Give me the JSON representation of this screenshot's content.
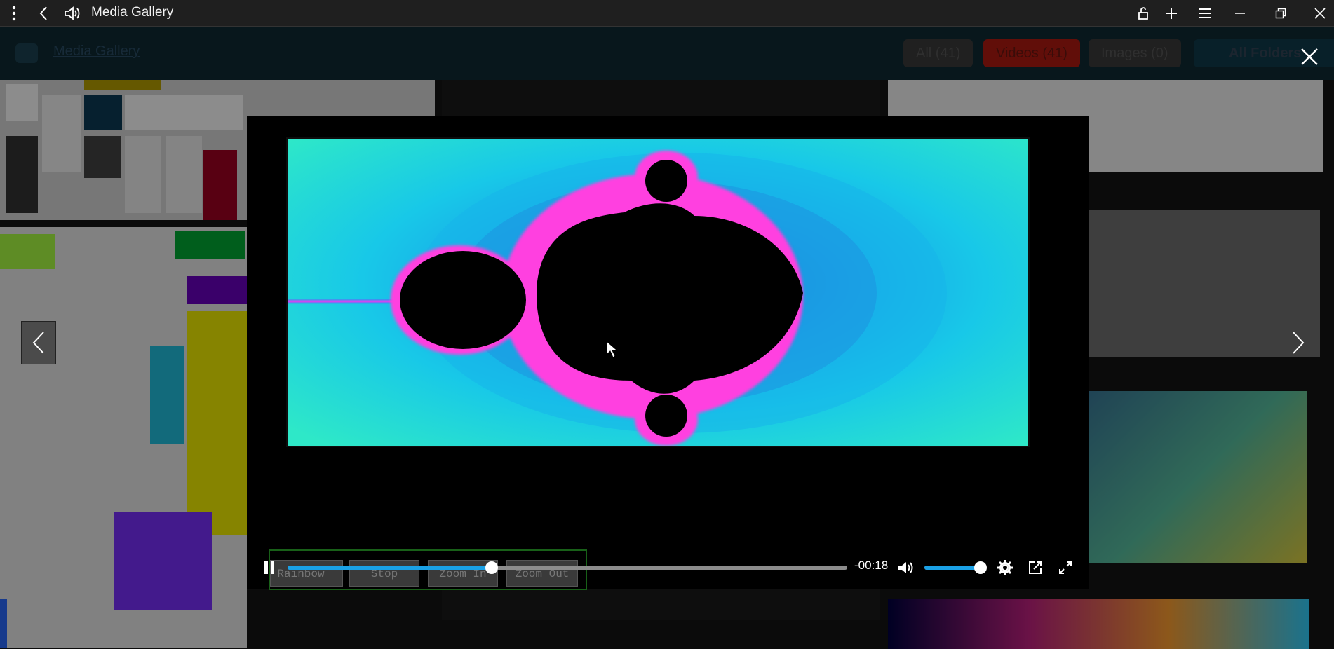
{
  "window": {
    "title": "Media Gallery",
    "icons": [
      "more-vert-icon",
      "back-icon",
      "volume-icon",
      "lock-icon",
      "plus-icon",
      "menu-icon",
      "minimize-icon",
      "restore-icon",
      "close-icon"
    ]
  },
  "gallery": {
    "title": "Media Gallery",
    "filters": [
      {
        "label": "All (41)",
        "color": "#3a3a3a"
      },
      {
        "label": "Videos (41)",
        "color": "#b11a10"
      },
      {
        "label": "Images (0)",
        "color": "#3a3a3a"
      },
      {
        "label": "All Folders",
        "color": "#0e3a4a"
      }
    ]
  },
  "fake_buttons": [
    "Rainbow",
    "Stop",
    "Zoom In",
    "Zoom Out"
  ],
  "player": {
    "time_remaining": "-00:18",
    "progress": 0.365,
    "volume": 1.0,
    "icons": [
      "pause-icon",
      "volume-icon",
      "settings-icon",
      "popout-icon",
      "fullscreen-icon"
    ]
  },
  "colors": {
    "accent": "#1aa1e6",
    "titlebar": "#1f1f1f",
    "fractal_outer": "#2ee8c8",
    "fractal_mid": "#1ec6e6",
    "fractal_edge": "#ff40e0"
  }
}
